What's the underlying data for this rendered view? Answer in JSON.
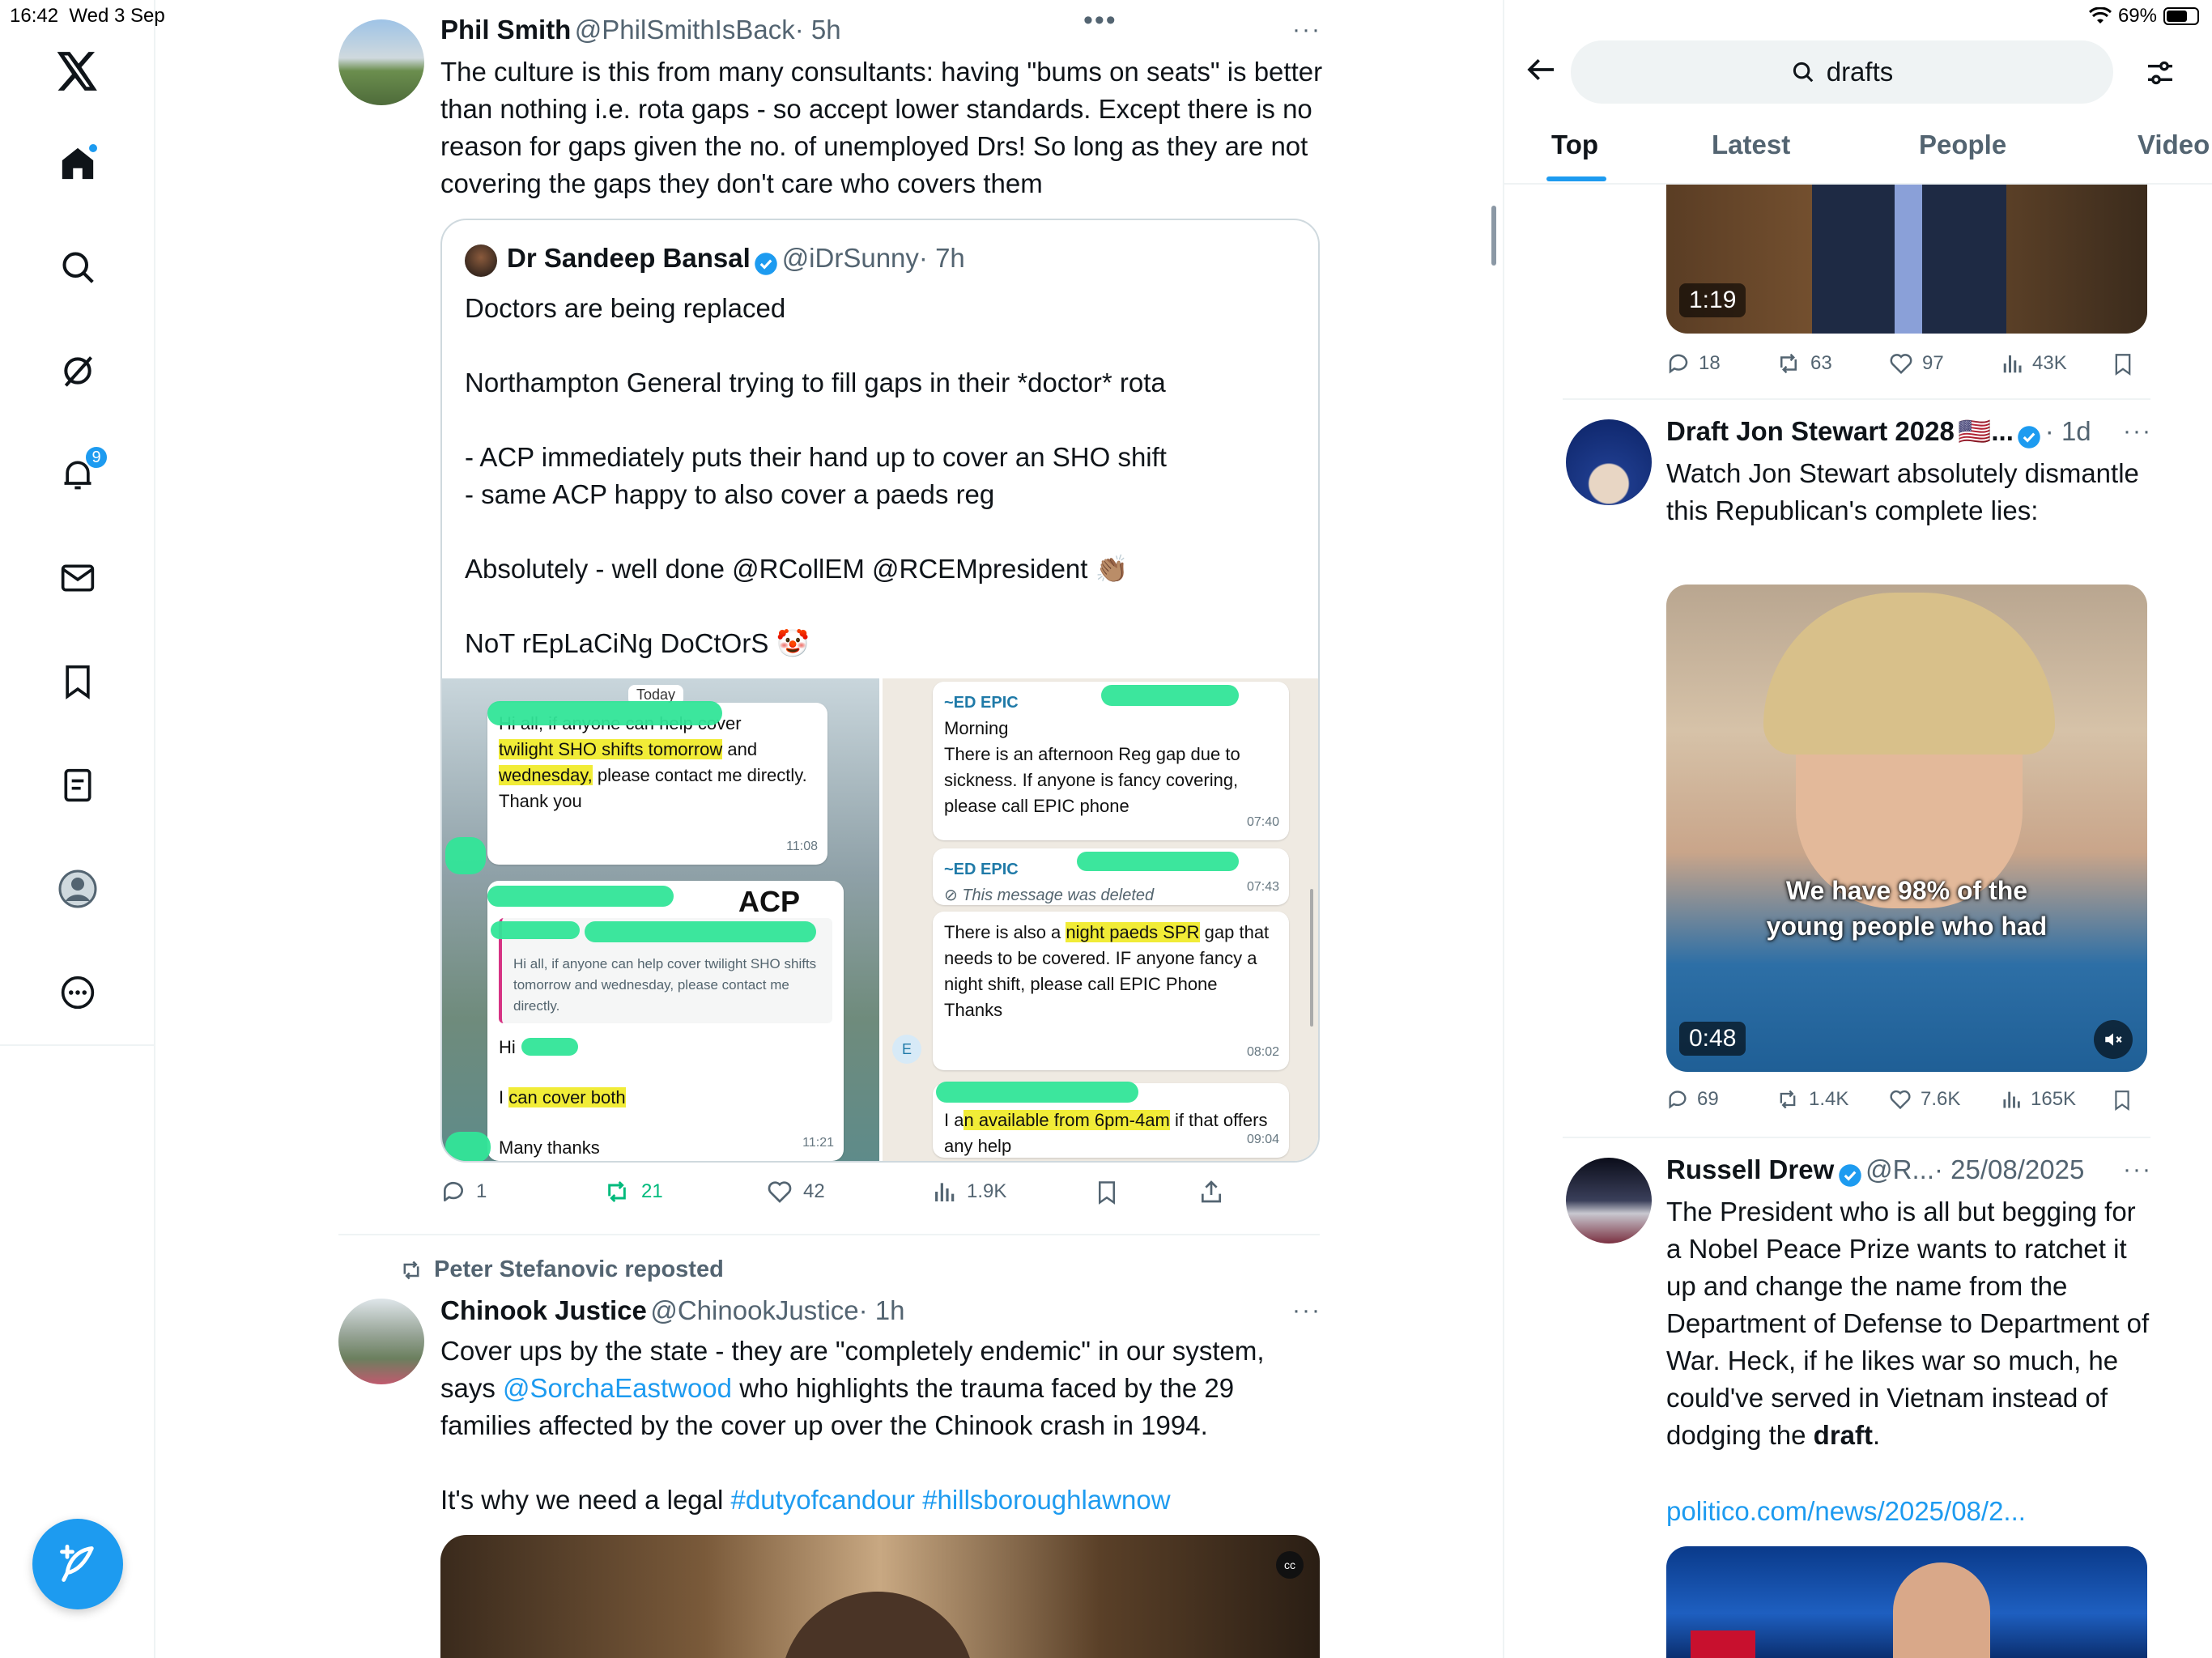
{
  "status": {
    "time": "16:42",
    "date": "Wed 3 Sep",
    "battery": "69%",
    "battery_level": 0.69
  },
  "sidebar": {
    "notifications_badge": "9",
    "items": [
      "home-icon",
      "search-icon",
      "grok-icon",
      "notifications-icon",
      "messages-icon",
      "bookmarks-icon",
      "lists-icon",
      "profile-icon",
      "more-icon"
    ]
  },
  "feed": {
    "tweet1": {
      "name": "Phil Smith",
      "handle": "@PhilSmithIsBack",
      "time": "· 5h",
      "text": "The culture is this from many consultants: having \"bums on seats\" is better than nothing i.e. rota gaps - so accept lower standards. Except there is no reason for gaps given the no. of unemployed Drs! So long as they are not covering the gaps they don't care who covers them",
      "quote": {
        "name": "Dr Sandeep Bansal",
        "handle": "@iDrSunny",
        "time": "· 7h",
        "text": "Doctors are being replaced\n\nNorthampton General trying to fill gaps in their *doctor* rota\n\n- ACP immediately puts their hand up to cover an SHO shift\n- same ACP happy to also cover a paeds reg\n\nAbsolutely - well done @RCollEM @RCEMpresident 👏🏽\n\nNoT rEpLaCiNg DoCtOrS 🤡"
      },
      "chat_left": {
        "today": "Today",
        "msg1_a": "Hi all, if anyone can help cover",
        "msg1_b": "twilight SHO shifts tomorrow",
        "msg1_c": "and",
        "msg1_d": "wednesday,",
        "msg1_e": "please contact me directly.",
        "msg1_f": "Thank you",
        "msg1_time": "11:08",
        "acp": "ACP",
        "quoted": "Hi all, if anyone can help cover twilight SHO shifts tomorrow and wednesday, please contact me directly.",
        "hi": "Hi",
        "cover_a": "I",
        "cover_b": "can cover both",
        "thanks": "Many thanks",
        "msg2_time": "11:21"
      },
      "chat_right": {
        "sender1": "~ED EPIC",
        "msg1": "Morning\nThere is an afternoon Reg gap due to sickness. If anyone is fancy covering, please call EPIC phone",
        "msg1_time": "07:40",
        "sender2": "~ED EPIC",
        "deleted": "This message was deleted",
        "deleted_time": "07:43",
        "msg2_a": "There is also a",
        "msg2_b": "night paeds SPR",
        "msg2_c": "gap that needs to be covered. IF anyone fancy a night shift, please call EPIC Phone\nThanks",
        "msg2_time": "08:02",
        "avatar_letter": "E",
        "msg3_a": "I a",
        "msg3_b": "n available from 6pm-4am",
        "msg3_c": "if that offers any help",
        "msg3_time": "09:04"
      },
      "actions": {
        "replies": "1",
        "reposts": "21",
        "likes": "42",
        "views": "1.9K"
      }
    },
    "tweet2": {
      "reposted_by": "Peter Stefanovic reposted",
      "name": "Chinook Justice",
      "handle": "@ChinookJustice",
      "time": "· 1h",
      "text_a": "Cover ups by the state - they are \"completely endemic\" in our system, says",
      "mention": "@SorchaEastwood",
      "text_b": "who highlights the trauma faced by the 29 families affected by the cover up over the Chinook crash in 1994.",
      "text_c": "It's why we need a legal",
      "hashtag1": "#dutyofcandour",
      "hashtag2": "#hillsboroughlawnow"
    }
  },
  "search_panel": {
    "query": "drafts",
    "tabs": [
      "Top",
      "Latest",
      "People",
      "Video"
    ],
    "result0": {
      "duration": "1:19",
      "replies": "18",
      "reposts": "63",
      "likes": "97",
      "views": "43K"
    },
    "result1": {
      "name": "Draft Jon Stewart 2028",
      "flag": "🇺🇸...",
      "time": "· 1d",
      "text": "Watch Jon Stewart absolutely dismantle this Republican's complete lies:",
      "caption_1": "We have 98% of the",
      "caption_2": "young people who had",
      "duration": "0:48",
      "replies": "69",
      "reposts": "1.4K",
      "likes": "7.6K",
      "views": "165K"
    },
    "result2": {
      "name": "Russell Drew",
      "handle": "@R...",
      "time": "· 25/08/2025",
      "text_a": "The President who is all but begging for a Nobel Peace Prize wants to ratchet it up and change the name from the Department of Defense to Department of War. Heck, if he likes war so much, he could've served in Vietnam instead of dodging the",
      "text_bold": "draft",
      "text_end": ".",
      "link": "politico.com/news/2025/08/2..."
    }
  },
  "colors": {
    "accent": "#1d9bf0",
    "retweet_green": "#00ba7c",
    "text": "#0f1419",
    "muted": "#536471"
  }
}
